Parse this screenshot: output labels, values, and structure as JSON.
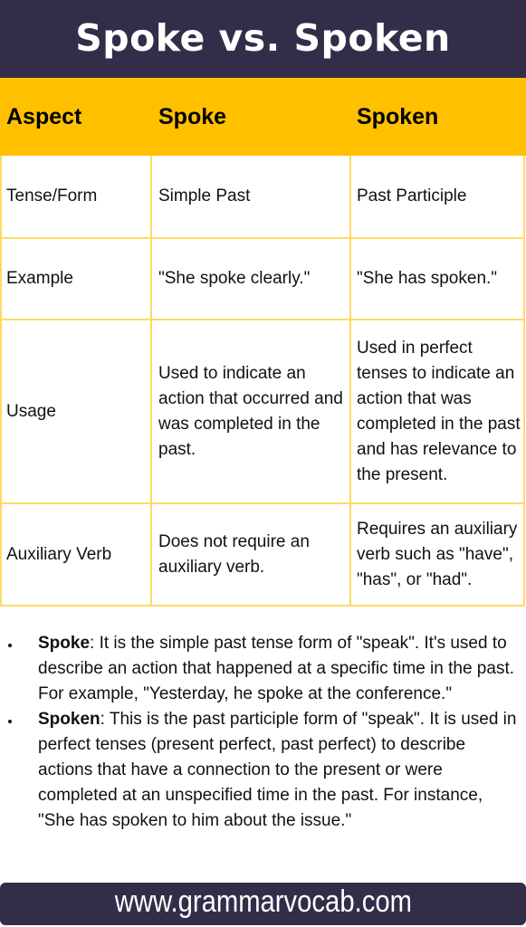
{
  "title": "Spoke vs. Spoken",
  "colors": {
    "header_bg": "#332d4a",
    "accent_yellow": "#ffc000",
    "border_yellow": "#ffd966"
  },
  "table": {
    "headers": [
      "Aspect",
      "Spoke",
      "Spoken"
    ],
    "rows": [
      {
        "aspect": "Tense/Form",
        "spoke": "Simple Past",
        "spoken": "Past Participle"
      },
      {
        "aspect": "Example",
        "spoke": "\"She spoke clearly.\"",
        "spoken": "\"She has spoken.\""
      },
      {
        "aspect": "Usage",
        "spoke": "Used to indicate an action that occurred and was completed in the past.",
        "spoken": "Used in perfect tenses to indicate an action that was completed in the past and has relevance to the present."
      },
      {
        "aspect": "Auxiliary Verb",
        "spoke": "Does not require an auxiliary verb.",
        "spoken": "Requires an auxiliary verb such as \"have\", \"has\", or \"had\"."
      }
    ]
  },
  "bullets": [
    {
      "term": "Spoke",
      "text": ": It is the simple past tense form of \"speak\". It's used to describe an action that happened at a specific time in the past. For example, \"Yesterday, he spoke at the conference.\""
    },
    {
      "term": "Spoken",
      "text": ": This is the past participle form of \"speak\". It is used in perfect tenses (present perfect, past perfect) to describe actions that have a connection to the present or were completed at an unspecified time in the past. For instance, \"She has spoken to him about the issue.\""
    }
  ],
  "footer": {
    "website": "www.grammarvocab.com"
  }
}
